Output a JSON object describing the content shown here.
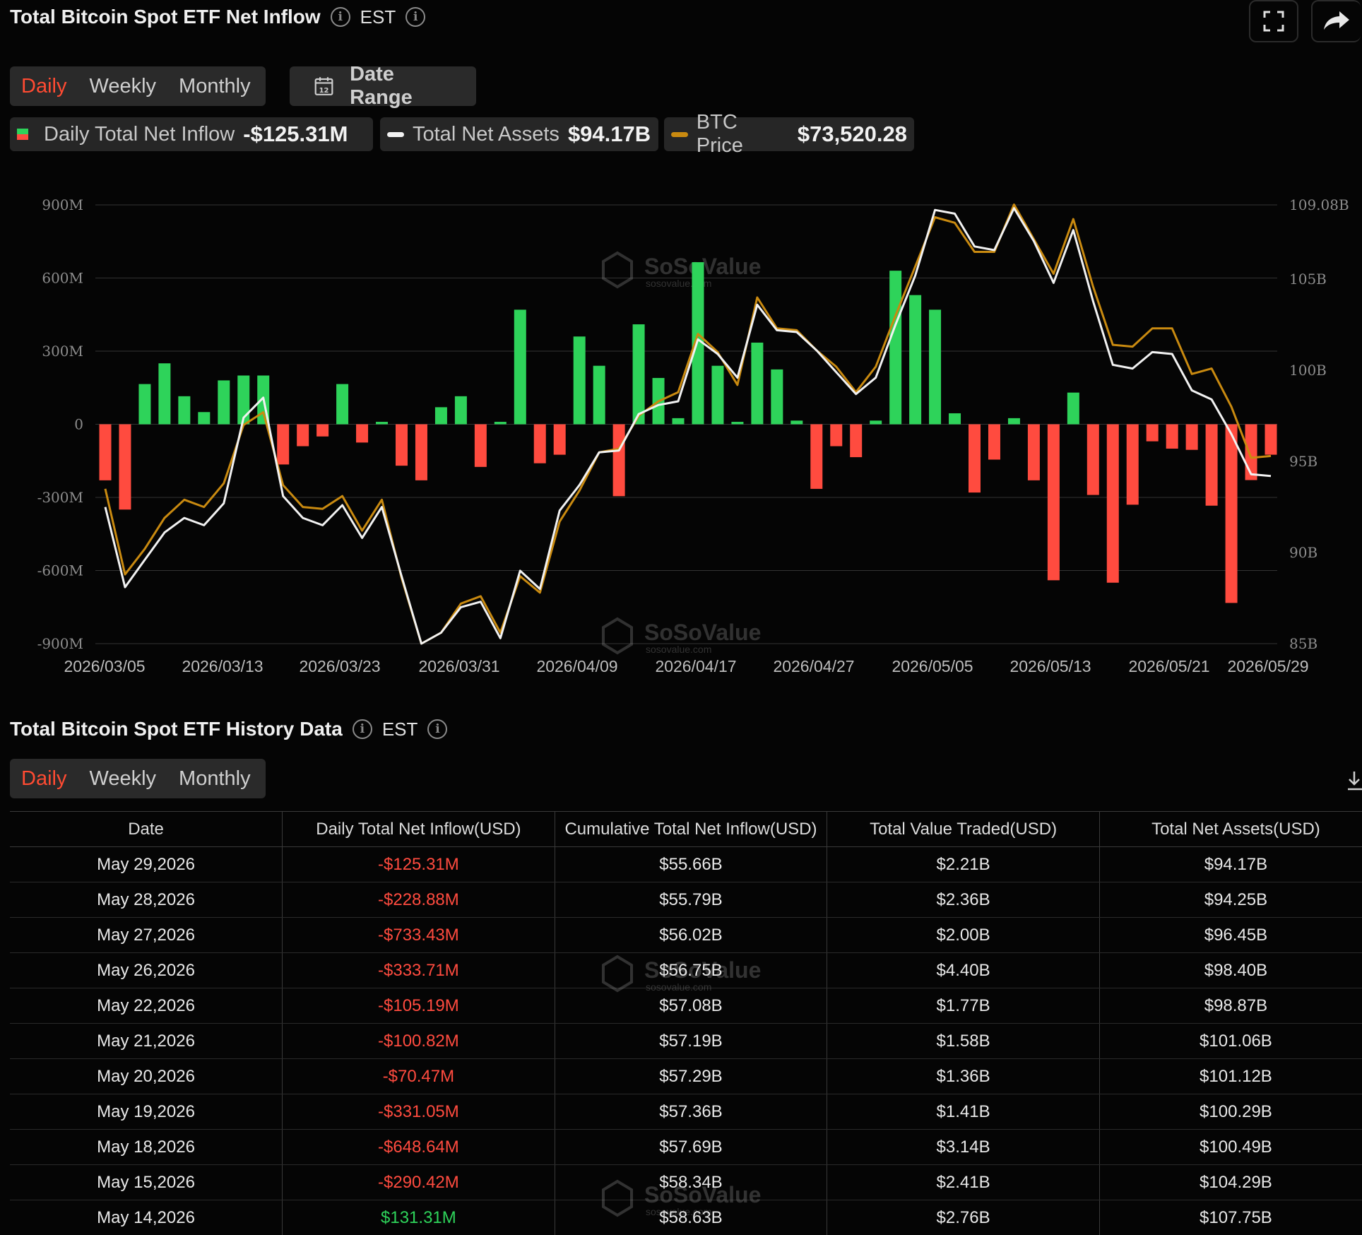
{
  "header": {
    "title": "Total Bitcoin Spot ETF Net Inflow",
    "timezone": "EST"
  },
  "tabs": [
    "Daily",
    "Weekly",
    "Monthly"
  ],
  "date_range_label": "Date Range",
  "date_range_icon_text": "12",
  "legend": {
    "inflow_label": "Daily Total Net Inflow",
    "inflow_value": "-$125.31M",
    "assets_label": "Total Net Assets",
    "assets_value": "$94.17B",
    "btc_label": "BTC Price",
    "btc_value": "$73,520.28"
  },
  "colors": {
    "positive": "#2ed35a",
    "negative": "#ff4b3f",
    "assets_line": "#f2f2f2",
    "btc_line": "#c98a10",
    "active_tab": "#ff4b32"
  },
  "watermark": {
    "name": "SoSoValue",
    "url": "sosovalue.com"
  },
  "chart_data": {
    "type": "bar",
    "y_left_ticks": [
      "900M",
      "600M",
      "300M",
      "0",
      "-300M",
      "-600M",
      "-900M"
    ],
    "y_left_range": [
      -900,
      900
    ],
    "y_right_ticks": [
      "109.08B",
      "105B",
      "100B",
      "95B",
      "90B",
      "85B"
    ],
    "y_right_range": [
      85,
      109.08
    ],
    "x_tick_labels": [
      "2026/03/05",
      "2026/03/13",
      "2026/03/23",
      "2026/03/31",
      "2026/04/09",
      "2026/04/17",
      "2026/04/27",
      "2026/05/05",
      "2026/05/13",
      "2026/05/21",
      "2026/05/29"
    ],
    "series": [
      {
        "name": "Daily Total Net Inflow",
        "values": [
          -230,
          -350,
          165,
          250,
          115,
          50,
          180,
          200,
          200,
          -165,
          -90,
          -50,
          165,
          -75,
          10,
          -170,
          -230,
          70,
          115,
          -175,
          10,
          470,
          -160,
          -125,
          360,
          240,
          -295,
          410,
          190,
          25,
          665,
          240,
          10,
          335,
          225,
          15,
          -265,
          -90,
          -135,
          15,
          630,
          530,
          470,
          45,
          -280,
          -145,
          25,
          -230,
          -640,
          130,
          -290,
          -650,
          -330,
          -70,
          -100,
          -105,
          -334,
          -733,
          -229,
          -125
        ]
      },
      {
        "name": "Total Net Assets",
        "values": [
          92.5,
          88.1,
          89.6,
          91.1,
          91.9,
          91.5,
          92.7,
          97.4,
          98.5,
          93.1,
          91.9,
          91.5,
          92.6,
          90.8,
          92.5,
          88.7,
          85.0,
          85.6,
          87.0,
          87.3,
          85.3,
          89.0,
          88.0,
          92.3,
          93.7,
          95.5,
          95.6,
          97.6,
          98.1,
          98.3,
          101.7,
          100.9,
          99.6,
          103.6,
          102.2,
          102.1,
          101.1,
          99.9,
          98.7,
          99.6,
          102.5,
          105.2,
          108.8,
          108.6,
          106.8,
          106.6,
          108.9,
          107.1,
          104.8,
          107.7,
          103.8,
          100.3,
          100.1,
          101.0,
          100.9,
          98.9,
          98.4,
          96.5,
          94.3,
          94.2
        ]
      },
      {
        "name": "BTC Price",
        "values": [
          93.5,
          88.8,
          90.2,
          91.9,
          92.9,
          92.5,
          93.8,
          97.0,
          97.7,
          93.7,
          92.5,
          92.4,
          93.1,
          91.2,
          92.9,
          88.6,
          85.0,
          85.6,
          87.2,
          87.6,
          85.6,
          88.7,
          87.8,
          91.7,
          93.4,
          95.5,
          95.7,
          97.5,
          98.3,
          98.8,
          102.0,
          101.0,
          99.2,
          104.0,
          102.3,
          102.2,
          101.1,
          100.2,
          98.8,
          100.2,
          103.0,
          105.7,
          108.4,
          108.1,
          106.5,
          106.5,
          109.1,
          107.2,
          105.3,
          108.3,
          104.6,
          101.4,
          101.3,
          102.3,
          102.3,
          99.8,
          100.1,
          98.0,
          95.2,
          95.3
        ]
      }
    ]
  },
  "history": {
    "title": "Total Bitcoin Spot ETF History Data",
    "timezone": "EST",
    "columns": [
      "Date",
      "Daily Total Net Inflow(USD)",
      "Cumulative Total Net Inflow(USD)",
      "Total Value Traded(USD)",
      "Total Net Assets(USD)"
    ],
    "rows": [
      [
        "May 29,2026",
        "-$125.31M",
        "$55.66B",
        "$2.21B",
        "$94.17B"
      ],
      [
        "May 28,2026",
        "-$228.88M",
        "$55.79B",
        "$2.36B",
        "$94.25B"
      ],
      [
        "May 27,2026",
        "-$733.43M",
        "$56.02B",
        "$2.00B",
        "$96.45B"
      ],
      [
        "May 26,2026",
        "-$333.71M",
        "$56.75B",
        "$4.40B",
        "$98.40B"
      ],
      [
        "May 22,2026",
        "-$105.19M",
        "$57.08B",
        "$1.77B",
        "$98.87B"
      ],
      [
        "May 21,2026",
        "-$100.82M",
        "$57.19B",
        "$1.58B",
        "$101.06B"
      ],
      [
        "May 20,2026",
        "-$70.47M",
        "$57.29B",
        "$1.36B",
        "$101.12B"
      ],
      [
        "May 19,2026",
        "-$331.05M",
        "$57.36B",
        "$1.41B",
        "$100.29B"
      ],
      [
        "May 18,2026",
        "-$648.64M",
        "$57.69B",
        "$3.14B",
        "$100.49B"
      ],
      [
        "May 15,2026",
        "-$290.42M",
        "$58.34B",
        "$2.41B",
        "$104.29B"
      ],
      [
        "May 14,2026",
        "$131.31M",
        "$58.63B",
        "$2.76B",
        "$107.75B"
      ]
    ]
  }
}
